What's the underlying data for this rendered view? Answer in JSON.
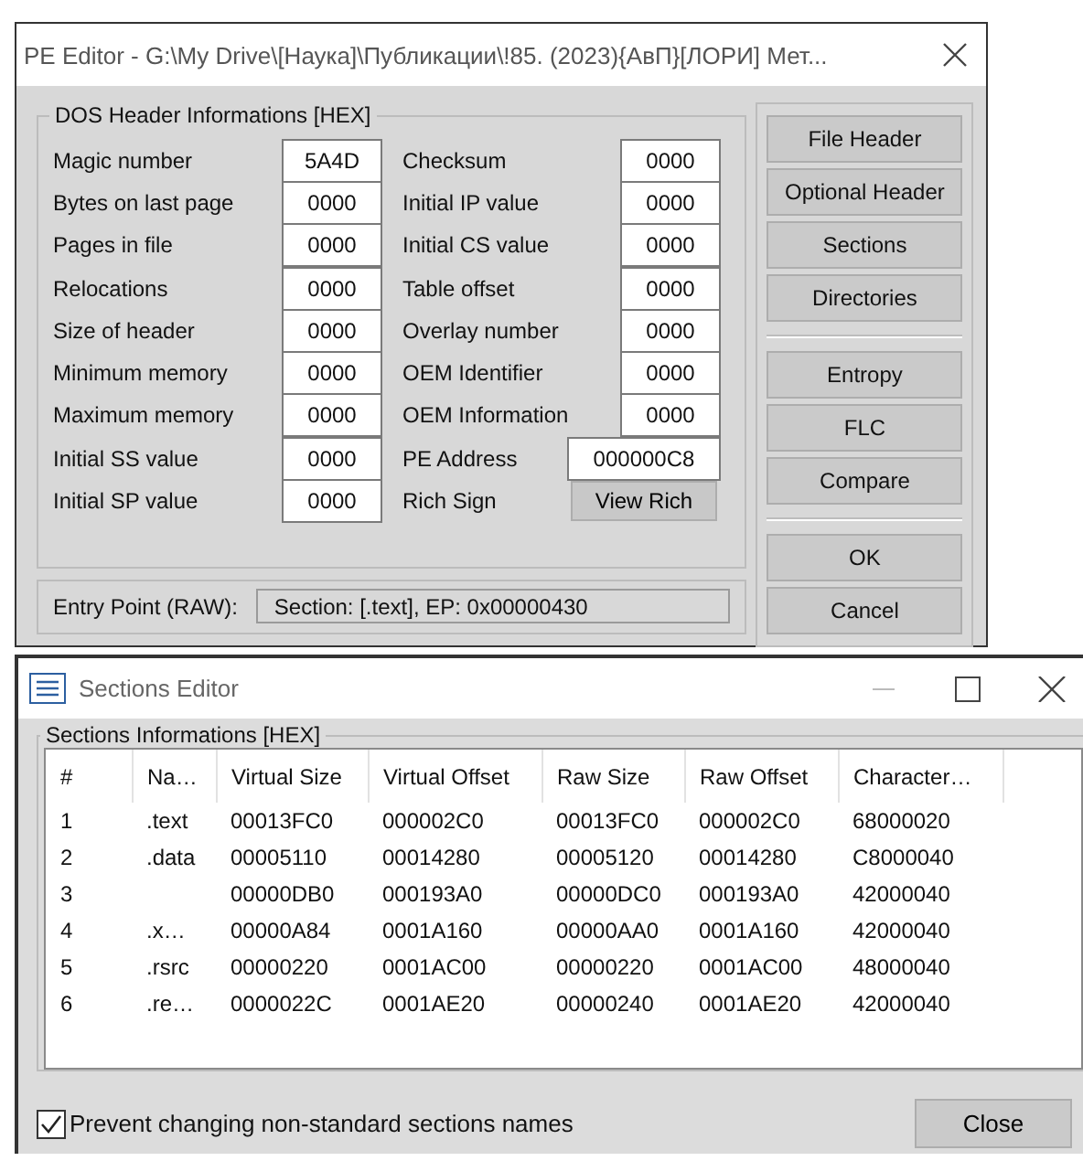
{
  "pe_editor": {
    "title": "PE Editor - G:\\My Drive\\[Наука]\\Публикации\\!85. (2023){АвП}[ЛОРИ] Мет...",
    "dos_header": {
      "title": "DOS Header Informations [HEX]",
      "left": [
        {
          "label": "Magic number",
          "value": "5A4D"
        },
        {
          "label": "Bytes on last page",
          "value": "0000"
        },
        {
          "label": "Pages in file",
          "value": "0000"
        },
        {
          "label": "Relocations",
          "value": "0000"
        },
        {
          "label": "Size of header",
          "value": "0000"
        },
        {
          "label": "Minimum memory",
          "value": "0000"
        },
        {
          "label": "Maximum memory",
          "value": "0000"
        },
        {
          "label": "Initial SS value",
          "value": "0000"
        },
        {
          "label": "Initial SP value",
          "value": "0000"
        }
      ],
      "right": [
        {
          "kind": "field",
          "label": "Checksum",
          "value": "0000"
        },
        {
          "kind": "field",
          "label": "Initial IP value",
          "value": "0000"
        },
        {
          "kind": "field",
          "label": "Initial CS value",
          "value": "0000"
        },
        {
          "kind": "field",
          "label": "Table offset",
          "value": "0000"
        },
        {
          "kind": "field",
          "label": "Overlay number",
          "value": "0000"
        },
        {
          "kind": "field",
          "label": "OEM Identifier",
          "value": "0000"
        },
        {
          "kind": "field",
          "label": "OEM Information",
          "value": "0000"
        },
        {
          "kind": "wide",
          "label": "PE Address",
          "value": "000000C8"
        },
        {
          "kind": "button",
          "label": "Rich Sign",
          "value": "View Rich"
        }
      ]
    },
    "entry_point": {
      "label": "Entry Point (RAW):",
      "value": "Section: [.text], EP: 0x00000430"
    },
    "button_groups": [
      [
        "File Header",
        "Optional Header",
        "Sections",
        "Directories"
      ],
      [
        "Entropy",
        "FLC",
        "Compare"
      ],
      [
        "OK",
        "Cancel"
      ]
    ]
  },
  "sections_editor": {
    "title": "Sections Editor",
    "group_title": "Sections Informations [HEX]",
    "columns": [
      "#",
      "Na…",
      "Virtual Size",
      "Virtual Offset",
      "Raw Size",
      "Raw Offset",
      "Character…"
    ],
    "rows": [
      [
        "1",
        ".text",
        "00013FC0",
        "000002C0",
        "00013FC0",
        "000002C0",
        "68000020"
      ],
      [
        "2",
        ".data",
        "00005110",
        "00014280",
        "00005120",
        "00014280",
        "C8000040"
      ],
      [
        "3",
        "",
        "00000DB0",
        "000193A0",
        "00000DC0",
        "000193A0",
        "42000040"
      ],
      [
        "4",
        ".x…",
        "00000A84",
        "0001A160",
        "00000AA0",
        "0001A160",
        "42000040"
      ],
      [
        "5",
        ".rsrc",
        "00000220",
        "0001AC00",
        "00000220",
        "0001AC00",
        "48000040"
      ],
      [
        "6",
        ".re…",
        "0000022C",
        "0001AE20",
        "00000240",
        "0001AE20",
        "42000040"
      ]
    ],
    "checkbox": {
      "label": "Prevent changing non-standard sections names",
      "checked": true
    },
    "close_button": "Close"
  }
}
